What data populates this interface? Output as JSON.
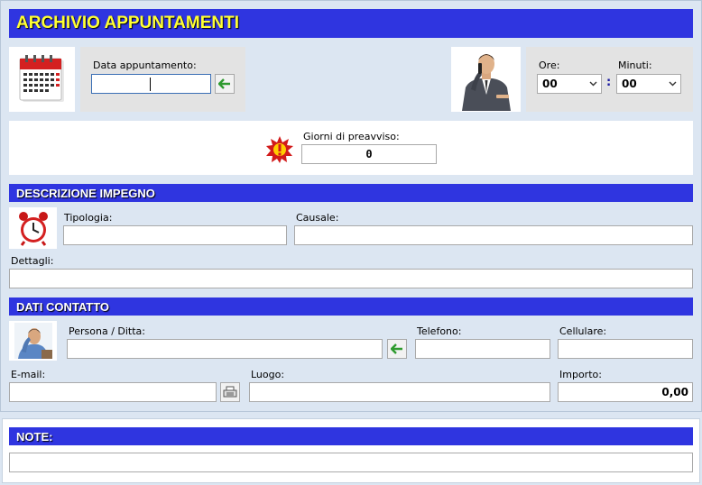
{
  "header": {
    "title": "ARCHIVIO APPUNTAMENTI"
  },
  "appointment": {
    "date_label": "Data appuntamento:",
    "date_value": "",
    "hours_label": "Ore:",
    "hours_value": "00",
    "minutes_label": "Minuti:",
    "minutes_value": "00",
    "time_separator": ":"
  },
  "notice": {
    "label": "Giorni di preavviso:",
    "value": "0"
  },
  "description": {
    "section_title": "DESCRIZIONE IMPEGNO",
    "type_label": "Tipologia:",
    "type_value": "",
    "reason_label": "Causale:",
    "reason_value": "",
    "details_label": "Dettagli:",
    "details_value": ""
  },
  "contact": {
    "section_title": "DATI CONTATTO",
    "person_label": "Persona / Ditta:",
    "person_value": "",
    "phone_label": "Telefono:",
    "phone_value": "",
    "mobile_label": "Cellulare:",
    "mobile_value": "",
    "email_label": "E-mail:",
    "email_value": "",
    "place_label": "Luogo:",
    "place_value": "",
    "amount_label": "Importo:",
    "amount_value": "0,00"
  },
  "notes": {
    "section_title": "NOTE:",
    "value": ""
  },
  "colors": {
    "banner": "#2f35e0",
    "title_text": "#ffff33",
    "background": "#dce6f2",
    "arrow": "#2e9a2e"
  },
  "icons": {
    "calendar": "calendar-icon",
    "businessman_phone": "businessman-phone-icon",
    "alert_burst": "alert-burst-icon",
    "alarm_clock": "alarm-clock-icon",
    "contact_person": "contact-person-icon",
    "arrow_left": "arrow-left-icon",
    "email_send": "email-send-icon",
    "chevron_down": "chevron-down-icon"
  }
}
